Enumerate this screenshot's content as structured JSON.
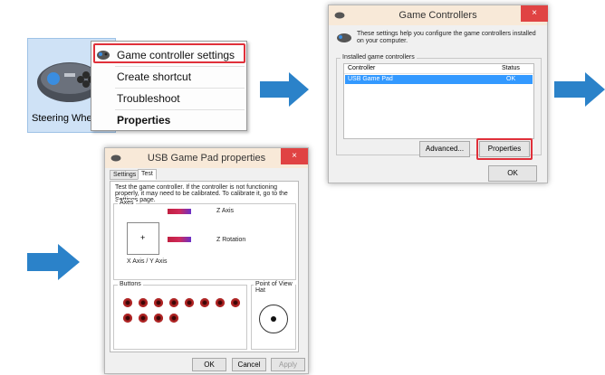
{
  "panel1": {
    "device_label": "Steering Wheel",
    "menu_items": [
      {
        "label": "Game controller settings",
        "icon": "gamepad-icon"
      },
      {
        "label": "Create shortcut"
      },
      {
        "label": "Troubleshoot"
      },
      {
        "label": "Properties"
      }
    ],
    "highlight_color": "#e0303a"
  },
  "panel2": {
    "title": "Game Controllers",
    "close_glyph": "×",
    "intro": "These settings help you configure the game controllers installed on your computer.",
    "group_label": "Installed game controllers",
    "columns": [
      "Controller",
      "Status"
    ],
    "rows": [
      {
        "controller": "USB Game Pad",
        "status": "OK"
      }
    ],
    "advanced_button": "Advanced...",
    "properties_button": "Properties",
    "ok_button": "OK",
    "selection_color": "#3399ff"
  },
  "panel3": {
    "title": "USB Game Pad  properties",
    "close_glyph": "×",
    "tabs": [
      "Settings",
      "Test"
    ],
    "active_tab": "Test",
    "instruction": "Test the game controller.  If the controller is not functioning properly, it may need to be calibrated.  To calibrate it, go to the Settings page.",
    "axes_label": "Axes",
    "z_axis": "Z Axis",
    "z_rotation": "Z Rotation",
    "xy_axis": "X Axis / Y Axis",
    "crosshair": "+",
    "buttons_label": "Buttons",
    "pov_label": "Point of View Hat",
    "ok_button": "OK",
    "cancel_button": "Cancel",
    "apply_button": "Apply",
    "button_dot_count": 12
  },
  "arrow_color": "#2b82c9"
}
